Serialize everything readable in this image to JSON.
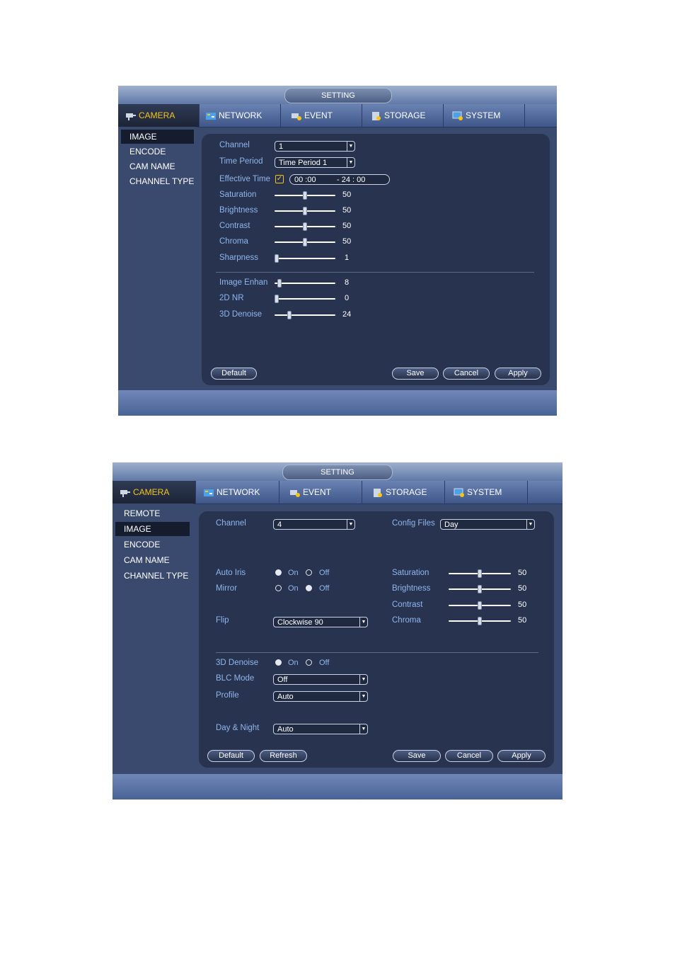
{
  "window1": {
    "title": "SETTING",
    "tabs": [
      {
        "label": "CAMERA",
        "icon": "camera-icon"
      },
      {
        "label": "NETWORK",
        "icon": "network-icon"
      },
      {
        "label": "EVENT",
        "icon": "event-icon"
      },
      {
        "label": "STORAGE",
        "icon": "storage-icon"
      },
      {
        "label": "SYSTEM",
        "icon": "system-icon"
      }
    ],
    "sidebar": [
      "IMAGE",
      "ENCODE",
      "CAM NAME",
      "CHANNEL TYPE"
    ],
    "channel_label": "Channel",
    "channel_value": "1",
    "time_period_label": "Time Period",
    "time_period_value": "Time Period 1",
    "effective_time_label": "Effective Time",
    "effective_checked": true,
    "time_start": "00 :00",
    "time_end": "- 24 : 00",
    "sliders": [
      {
        "label": "Saturation",
        "value": 50
      },
      {
        "label": "Brightness",
        "value": 50
      },
      {
        "label": "Contrast",
        "value": 50
      },
      {
        "label": "Chroma",
        "value": 50
      },
      {
        "label": "Sharpness",
        "value": 1
      },
      {
        "label": "Image Enhan",
        "value": 8
      },
      {
        "label": "2D NR",
        "value": 0
      },
      {
        "label": "3D Denoise",
        "value": 24
      }
    ],
    "buttons": {
      "default": "Default",
      "save": "Save",
      "cancel": "Cancel",
      "apply": "Apply"
    }
  },
  "window2": {
    "title": "SETTING",
    "tabs": [
      {
        "label": "CAMERA",
        "icon": "camera-icon"
      },
      {
        "label": "NETWORK",
        "icon": "network-icon"
      },
      {
        "label": "EVENT",
        "icon": "event-icon"
      },
      {
        "label": "STORAGE",
        "icon": "storage-icon"
      },
      {
        "label": "SYSTEM",
        "icon": "system-icon"
      }
    ],
    "sidebar": [
      "REMOTE",
      "IMAGE",
      "ENCODE",
      "CAM NAME",
      "CHANNEL TYPE"
    ],
    "channel_label": "Channel",
    "channel_value": "4",
    "config_files_label": "Config Files",
    "config_files_value": "Day",
    "auto_iris_label": "Auto Iris",
    "mirror_label": "Mirror",
    "on_label": "On",
    "off_label": "Off",
    "auto_iris_on": true,
    "mirror_on": false,
    "flip_label": "Flip",
    "flip_value": "Clockwise 90",
    "sliders": [
      {
        "label": "Saturation",
        "value": 50
      },
      {
        "label": "Brightness",
        "value": 50
      },
      {
        "label": "Contrast",
        "value": 50
      },
      {
        "label": "Chroma",
        "value": 50
      }
    ],
    "denoise_label": "3D Denoise",
    "denoise_on": true,
    "blc_label": "BLC Mode",
    "blc_value": "Off",
    "profile_label": "Profile",
    "profile_value": "Auto",
    "daynight_label": "Day & Night",
    "daynight_value": "Auto",
    "buttons": {
      "default": "Default",
      "refresh": "Refresh",
      "save": "Save",
      "cancel": "Cancel",
      "apply": "Apply"
    }
  }
}
